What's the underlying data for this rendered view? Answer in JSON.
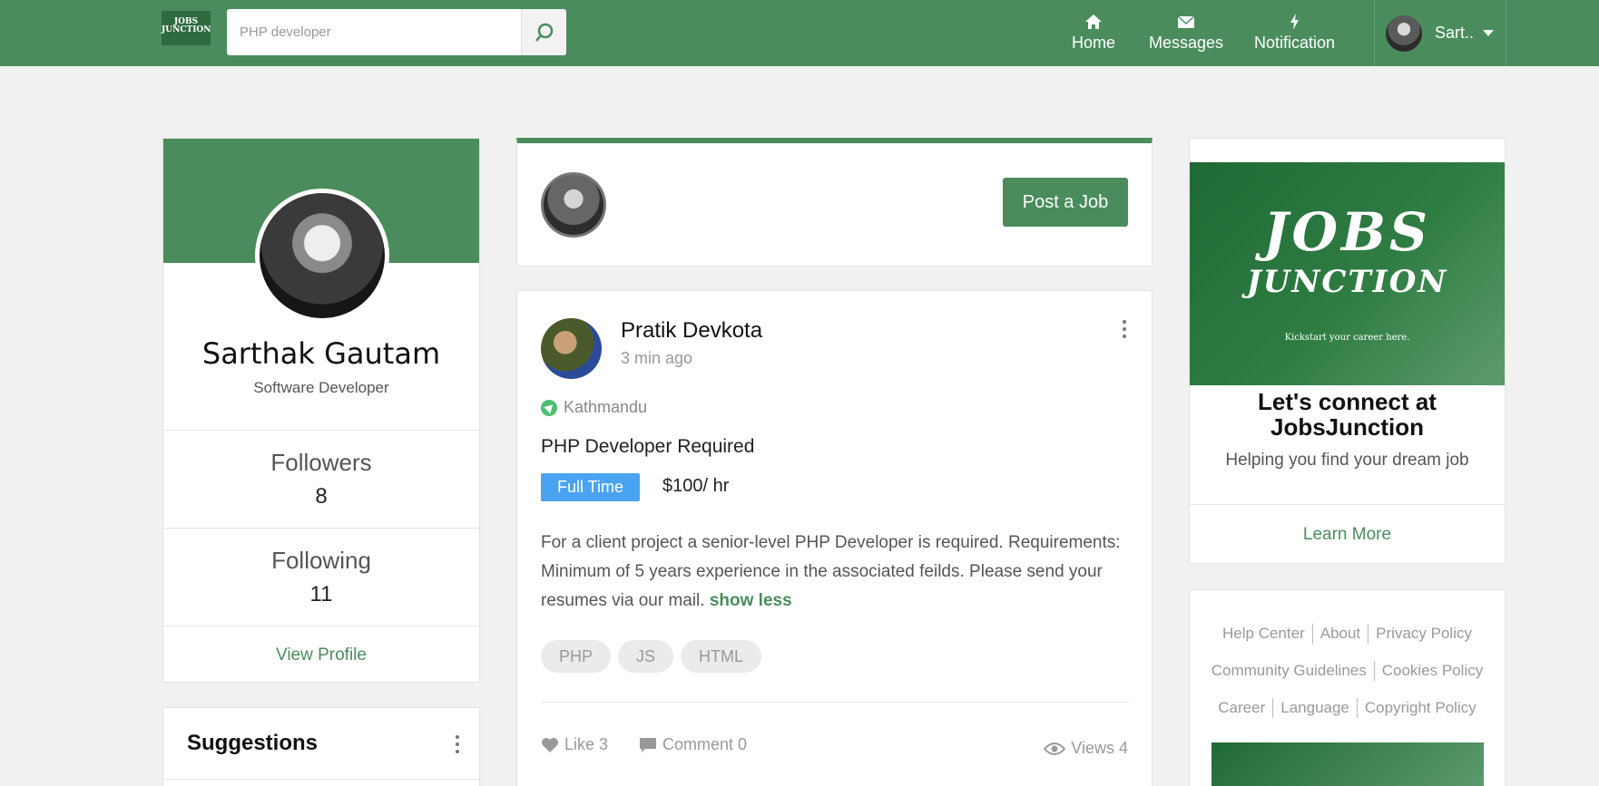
{
  "header": {
    "logo_text": "JOBS JUNCTION",
    "search_placeholder": "PHP developer",
    "nav": [
      {
        "label": "Home",
        "icon": "home-icon"
      },
      {
        "label": "Messages",
        "icon": "envelope-icon"
      },
      {
        "label": "Notification",
        "icon": "lightning-icon"
      }
    ],
    "user_name": "Sart.."
  },
  "profile": {
    "name": "Sarthak Gautam",
    "title": "Software Developer",
    "followers_label": "Followers",
    "followers": "8",
    "following_label": "Following",
    "following": "11",
    "view_profile": "View Profile"
  },
  "suggestions": {
    "title": "Suggestions"
  },
  "post_box": {
    "button": "Post a Job"
  },
  "post": {
    "author": "Pratik Devkota",
    "time": "3 min ago",
    "location": "Kathmandu",
    "title": "PHP Developer Required",
    "job_type": "Full Time",
    "rate": "$100/ hr",
    "description": "For a client project a senior-level PHP Developer is required. Requirements: Minimum of 5 years experience in the associated feilds. Please send your resumes via our mail.",
    "show_less": "show less",
    "tags": [
      "PHP",
      "JS",
      "HTML"
    ],
    "like": "Like 3",
    "comment": "Comment 0",
    "views": "Views 4"
  },
  "promo": {
    "logo_line1": "JOBS",
    "logo_line2": "JUNCTION",
    "tagline": "Kickstart your career here.",
    "heading": "Let's connect at JobsJunction",
    "subheading": "Helping you find your dream job",
    "cta": "Learn More"
  },
  "footer_links": {
    "row1": [
      "Help Center",
      "About",
      "Privacy Policy"
    ],
    "row2": [
      "Community Guidelines",
      "Cookies Policy"
    ],
    "row3": [
      "Career",
      "Language",
      "Copyright Policy"
    ]
  },
  "colors": {
    "brand": "#4a8c5c",
    "badge": "#4aa3f0",
    "background": "#f1f1f1"
  }
}
